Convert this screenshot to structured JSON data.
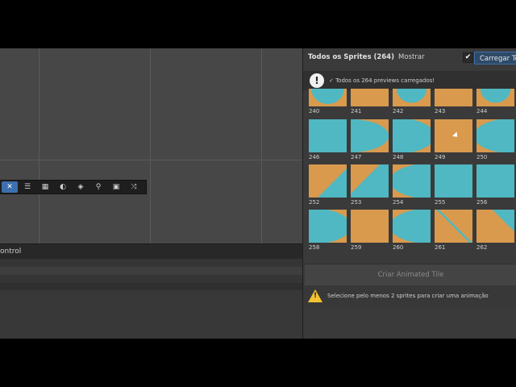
{
  "console": {
    "label": "ontrol"
  },
  "toolbar": {
    "icons": [
      "move-tool-icon",
      "align-icon",
      "grid-icon",
      "circle-tool-icon",
      "layers-icon",
      "zoom-icon",
      "snapshot-icon",
      "shuffle-icon"
    ]
  },
  "panel": {
    "title": "Todos os Sprites (264)",
    "show_label": "Mostrar",
    "checkbox_mark": "✔",
    "load_button": "Carregar Todos",
    "info_icon_text": "!",
    "info_text": "✓ Todos os 264 previews carregados!",
    "create_button": "Criar Animated Tile",
    "warn_mark": "!",
    "warning_text": "Selecione pelo menos 2 sprites para criar uma animação"
  },
  "tiles": [
    {
      "label": "240",
      "kind": "water-curve-bottom"
    },
    {
      "label": "241",
      "kind": "sand"
    },
    {
      "label": "242",
      "kind": "water-curve-top"
    },
    {
      "label": "243",
      "kind": "sand-edge"
    },
    {
      "label": "244",
      "kind": "water-curve-top"
    },
    {
      "label": "246",
      "kind": "water"
    },
    {
      "label": "247",
      "kind": "water-left-sand"
    },
    {
      "label": "248",
      "kind": "water-right-sand"
    },
    {
      "label": "249",
      "kind": "sand"
    },
    {
      "label": "250",
      "kind": "sand-left-water"
    },
    {
      "label": "252",
      "kind": "sand-diag-water"
    },
    {
      "label": "253",
      "kind": "water-diag-sand"
    },
    {
      "label": "254",
      "kind": "sand-left-water"
    },
    {
      "label": "255",
      "kind": "water"
    },
    {
      "label": "256",
      "kind": "water"
    },
    {
      "label": "258",
      "kind": "water-right-sand"
    },
    {
      "label": "259",
      "kind": "sand"
    },
    {
      "label": "260",
      "kind": "sand-left-water"
    },
    {
      "label": "261",
      "kind": "sand-x-water"
    },
    {
      "label": "262",
      "kind": "sand-v-water"
    }
  ],
  "colors": {
    "sand": "#d99a4e",
    "water": "#4fb8c2",
    "accent": "#3d6fae",
    "warning": "#f2c230"
  }
}
